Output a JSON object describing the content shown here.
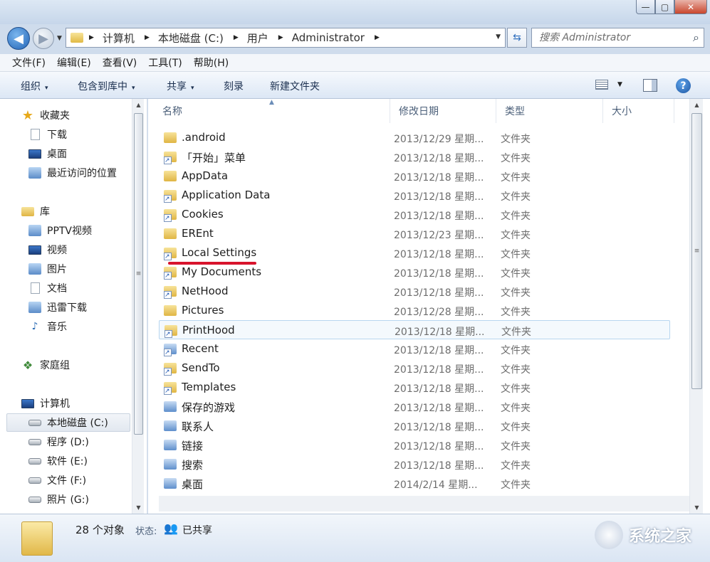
{
  "window": {
    "min": "—",
    "max": "▢",
    "close": "✕"
  },
  "nav": {
    "back": "◀",
    "forward": "▶",
    "recent": "▼"
  },
  "address": {
    "crumbs": [
      "计算机",
      "本地磁盘 (C:)",
      "用户",
      "Administrator"
    ],
    "dropdown": "▼",
    "refresh": "⇆"
  },
  "search": {
    "placeholder": "搜索 Administrator",
    "icon": "⌕"
  },
  "menu": [
    "文件(F)",
    "编辑(E)",
    "查看(V)",
    "工具(T)",
    "帮助(H)"
  ],
  "toolbar": {
    "organize": "组织",
    "include_library": "包含到库中",
    "share": "共享",
    "burn": "刻录",
    "new_folder": "新建文件夹",
    "help": "?",
    "dd": "▾"
  },
  "sidebar": {
    "favorites": {
      "label": "收藏夹",
      "items": [
        "下载",
        "桌面",
        "最近访问的位置"
      ]
    },
    "libraries": {
      "label": "库",
      "items": [
        "PPTV视频",
        "视频",
        "图片",
        "文档",
        "迅雷下载",
        "音乐"
      ]
    },
    "homegroup": "家庭组",
    "computer": {
      "label": "计算机",
      "items": [
        "本地磁盘 (C:)",
        "程序 (D:)",
        "软件 (E:)",
        "文件 (F:)",
        "照片 (G:)"
      ]
    }
  },
  "columns": {
    "name": "名称",
    "date": "修改日期",
    "type": "类型",
    "size": "大小",
    "sort_arrow": "▲"
  },
  "files": [
    {
      "name": ".android",
      "date": "2013/12/29 星期...",
      "type": "文件夹"
    },
    {
      "name": "「开始」菜单",
      "date": "2013/12/18 星期...",
      "type": "文件夹"
    },
    {
      "name": "AppData",
      "date": "2013/12/18 星期...",
      "type": "文件夹"
    },
    {
      "name": "Application Data",
      "date": "2013/12/18 星期...",
      "type": "文件夹"
    },
    {
      "name": "Cookies",
      "date": "2013/12/18 星期...",
      "type": "文件夹"
    },
    {
      "name": "EREnt",
      "date": "2013/12/23 星期...",
      "type": "文件夹"
    },
    {
      "name": "Local Settings",
      "date": "2013/12/18 星期...",
      "type": "文件夹"
    },
    {
      "name": "My Documents",
      "date": "2013/12/18 星期...",
      "type": "文件夹"
    },
    {
      "name": "NetHood",
      "date": "2013/12/18 星期...",
      "type": "文件夹"
    },
    {
      "name": "Pictures",
      "date": "2013/12/28 星期...",
      "type": "文件夹"
    },
    {
      "name": "PrintHood",
      "date": "2013/12/18 星期...",
      "type": "文件夹"
    },
    {
      "name": "Recent",
      "date": "2013/12/18 星期...",
      "type": "文件夹"
    },
    {
      "name": "SendTo",
      "date": "2013/12/18 星期...",
      "type": "文件夹"
    },
    {
      "name": "Templates",
      "date": "2013/12/18 星期...",
      "type": "文件夹"
    },
    {
      "name": "保存的游戏",
      "date": "2013/12/18 星期...",
      "type": "文件夹"
    },
    {
      "name": "联系人",
      "date": "2013/12/18 星期...",
      "type": "文件夹"
    },
    {
      "name": "链接",
      "date": "2013/12/18 星期...",
      "type": "文件夹"
    },
    {
      "name": "搜索",
      "date": "2013/12/18 星期...",
      "type": "文件夹"
    },
    {
      "name": "桌面",
      "date": "2014/2/14 星期...",
      "type": "文件夹"
    }
  ],
  "status": {
    "count": "28 个对象",
    "state_label": "状态:",
    "shared": "已共享"
  },
  "watermark": "系统之家",
  "scroll": {
    "up": "▲",
    "down": "▼",
    "grip": "≡"
  }
}
